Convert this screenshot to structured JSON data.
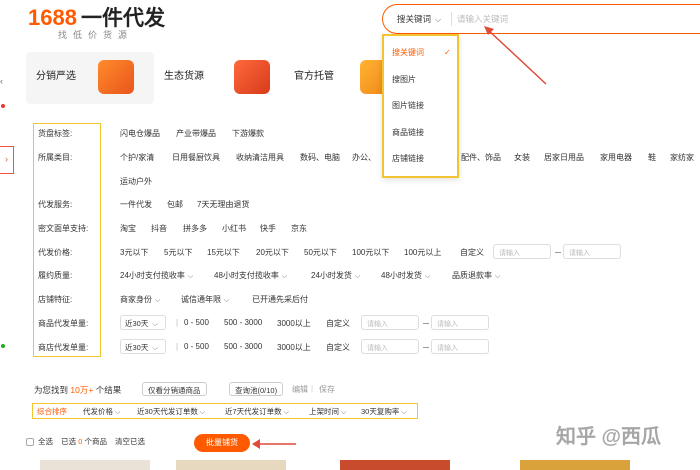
{
  "header": {
    "logo_number": "1688",
    "logo_text": "一件代发",
    "slogan": "找低价货源",
    "search": {
      "selected_type": "搜关键词",
      "placeholder": "请输入关键词"
    }
  },
  "search_dropdown": {
    "items": [
      "搜关键词",
      "搜图片",
      "图片链接",
      "商品链接",
      "店铺链接"
    ],
    "active_index": 0
  },
  "nav_tabs": [
    {
      "label": "分销严选"
    },
    {
      "label": "生态货源"
    },
    {
      "label": "官方托管"
    }
  ],
  "filters": {
    "goods_tag": {
      "label": "货盘标签:",
      "options": [
        "闪电仓爆品",
        "产业带爆品",
        "下游爆款"
      ]
    },
    "category": {
      "label": "所属类目:",
      "options": [
        "个护/家清",
        "日用餐厨饮具",
        "收纳清洁用具",
        "数码、电脑",
        "办公、",
        "配件、饰品",
        "女装",
        "居家日用品",
        "家用电器",
        "鞋",
        "家纺家",
        "运动户外"
      ]
    },
    "service": {
      "label": "代发服务:",
      "options": [
        "一件代发",
        "包邮",
        "7天无理由退货"
      ]
    },
    "platform": {
      "label": "密文面单支持:",
      "options": [
        "淘宝",
        "抖音",
        "拼多多",
        "小红书",
        "快手",
        "京东"
      ]
    },
    "price": {
      "label": "代发价格:",
      "options": [
        "3元以下",
        "5元以下",
        "15元以下",
        "20元以下",
        "50元以下",
        "100元以下",
        "100元以上",
        "自定义"
      ],
      "placeholder": "请输入"
    },
    "quality": {
      "label": "履约质量:",
      "options": [
        "24小时支付揽收率",
        "48小时支付揽收率",
        "24小时发货",
        "48小时发货",
        "品质退款率"
      ]
    },
    "store": {
      "label": "店铺特征:",
      "options": [
        "商家身份",
        "诚信通年限",
        "已开通先采后付"
      ]
    },
    "item_orders": {
      "label": "商品代发单量:",
      "period": "近30天",
      "options": [
        "0 - 500",
        "500 - 3000",
        "3000以上",
        "自定义"
      ],
      "placeholder": "请输入"
    },
    "shop_orders": {
      "label": "商店代发单量:",
      "period": "近30天",
      "options": [
        "0 - 500",
        "500 - 3000",
        "3000以上",
        "自定义"
      ],
      "placeholder": "请输入"
    }
  },
  "results": {
    "prefix": "为您找到",
    "count": "10万+",
    "suffix": "个结果",
    "only_distribution": "仅看分销通商品",
    "pool": "查询池(0/10)",
    "edit": "编辑",
    "save": "保存"
  },
  "sort_options": [
    "综合排序",
    "代发价格",
    "近30天代发订单数",
    "近7天代发订单数",
    "上架时间",
    "30天复购率"
  ],
  "bottom_bar": {
    "select_all": "全选",
    "selected_prefix": "已选",
    "selected_count": "0",
    "selected_suffix": "个商品",
    "clear": "清空已选",
    "bulk_button": "批量铺货"
  },
  "watermark": "知乎 @西瓜",
  "colors": {
    "accent": "#ff5a00",
    "highlight_border": "#f2c431",
    "arrow": "#e04a3a"
  }
}
